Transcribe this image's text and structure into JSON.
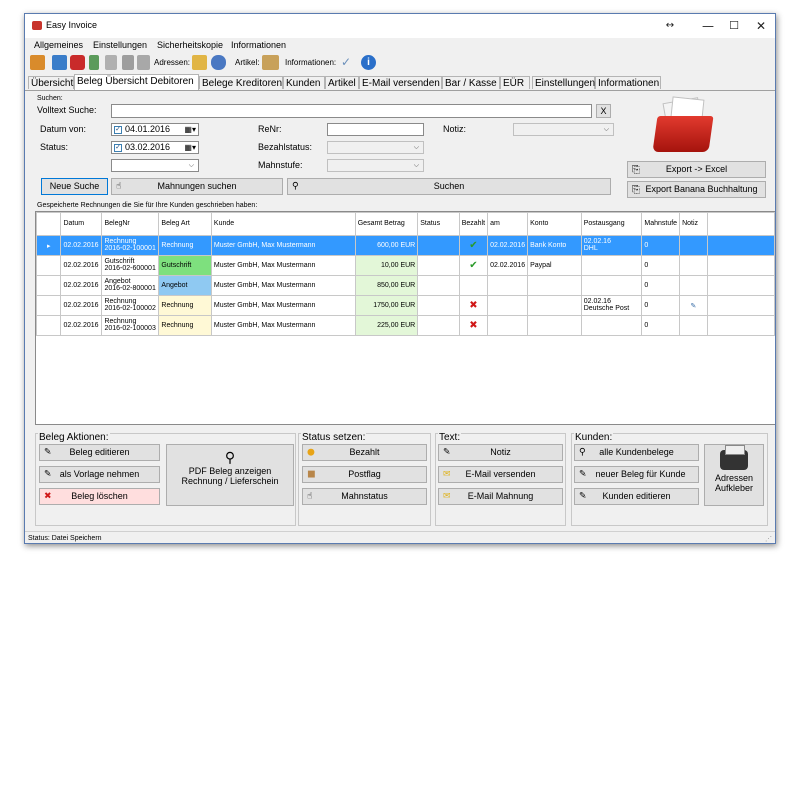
{
  "window": {
    "title": "Easy Invoice",
    "restore_icon": "double-arrow-icon",
    "minimize": "—",
    "maximize": "☐",
    "close": "✕"
  },
  "menu": [
    "Allgemeines",
    "Einstellungen",
    "Sicherheitskopie",
    "Informationen"
  ],
  "toolbar": {
    "adressen": "Adressen:",
    "artikel": "Artikel:",
    "informationen": "Informationen:"
  },
  "tabs": [
    "Übersicht",
    "Beleg Übersicht Debitoren",
    "Belege Kreditoren",
    "Kunden",
    "Artikel",
    "E-Mail versenden",
    "Bar / Kasse",
    "EÜR",
    "Einstellungen",
    "Informationen"
  ],
  "active_tab": 1,
  "search": {
    "section": "Suchen:",
    "volltext_label": "Volltext Suche:",
    "volltext_value": "",
    "clear": "X",
    "datum_von_label": "Datum von:",
    "datum_von_value": "04.01.2016",
    "status_label": "Status:",
    "status_date_value": "03.02.2016",
    "renr_label": "ReNr:",
    "notiz_label": "Notiz:",
    "bezahlstatus_label": "Bezahlstatus:",
    "mahnstufe_label": "Mahnstufe:",
    "neue_suche": "Neue Suche",
    "mahnungen_suchen": "Mahnungen suchen",
    "suchen": "Suchen"
  },
  "export": {
    "excel": "Export -> Excel",
    "banana": "Export Banana Buchhaltung"
  },
  "grid": {
    "caption": "Gespeicherte Rechnungen die Sie für Ihre Kunden geschrieben haben:",
    "headers": [
      "Datum",
      "BelegNr",
      "Beleg Art",
      "Kunde",
      "Gesamt Betrag",
      "Status",
      "Bezahlt",
      "am",
      "Konto",
      "Postausgang",
      "Mahnstufe",
      "Notiz"
    ],
    "rows": [
      {
        "datum": "02.02.2016",
        "nr1": "Rechnung",
        "nr2": "2016-02-100001",
        "art": "Rechnung",
        "kunde": "Muster GmbH, Max Mustermann",
        "betrag": "600,00 EUR",
        "status": "",
        "bezahlt": "check",
        "am": "02.02.2016",
        "konto": "Bank Konto",
        "post1": "02.02.16",
        "post2": "DHL",
        "mahn": "0",
        "notiz": ""
      },
      {
        "datum": "02.02.2016",
        "nr1": "Gutschrift",
        "nr2": "2016-02-600001",
        "art": "Gutschrift",
        "kunde": "Muster GmbH, Max Mustermann",
        "betrag": "10,00 EUR",
        "status": "",
        "bezahlt": "check",
        "am": "02.02.2016",
        "konto": "Paypal",
        "post1": "",
        "post2": "",
        "mahn": "0",
        "notiz": ""
      },
      {
        "datum": "02.02.2016",
        "nr1": "Angebot",
        "nr2": "2016-02-800001",
        "art": "Angebot",
        "kunde": "Muster GmbH, Max Mustermann",
        "betrag": "850,00 EUR",
        "status": "",
        "bezahlt": "",
        "am": "",
        "konto": "",
        "post1": "",
        "post2": "",
        "mahn": "0",
        "notiz": ""
      },
      {
        "datum": "02.02.2016",
        "nr1": "Rechnung",
        "nr2": "2016-02-100002",
        "art": "Rechnung",
        "kunde": "Muster GmbH, Max Mustermann",
        "betrag": "1750,00 EUR",
        "status": "",
        "bezahlt": "cross",
        "am": "",
        "konto": "",
        "post1": "02.02.16",
        "post2": "Deutsche Post",
        "mahn": "0",
        "notiz": "note"
      },
      {
        "datum": "02.02.2016",
        "nr1": "Rechnung",
        "nr2": "2016-02-100003",
        "art": "Rechnung",
        "kunde": "Muster GmbH, Max Mustermann",
        "betrag": "225,00 EUR",
        "status": "",
        "bezahlt": "cross",
        "am": "",
        "konto": "",
        "post1": "",
        "post2": "",
        "mahn": "0",
        "notiz": ""
      }
    ],
    "art_colors": {
      "Rechnung": "#fff9d6",
      "Gutschrift": "#7ee07e",
      "Angebot": "#8fc9f2"
    },
    "betrag_color": "#e3f7d8",
    "selected_color": "#3399ff"
  },
  "beleg_aktionen": {
    "title": "Beleg Aktionen:",
    "edit": "Beleg editieren",
    "vorlage": "als Vorlage nehmen",
    "delete": "Beleg löschen",
    "pdf1": "PDF Beleg anzeigen",
    "pdf2": "Rechnung / Lieferschein"
  },
  "status_setzen": {
    "title": "Status setzen:",
    "bezahlt": "Bezahlt",
    "postflag": "Postflag",
    "mahnstatus": "Mahnstatus"
  },
  "text": {
    "title": "Text:",
    "notiz": "Notiz",
    "email": "E-Mail versenden",
    "mahnung": "E-Mail Mahnung"
  },
  "kunden": {
    "title": "Kunden:",
    "alle": "alle Kundenbelege",
    "neuer": "neuer Beleg für Kunde",
    "editieren": "Kunden editieren",
    "adressen1": "Adressen",
    "adressen2": "Aufkleber"
  },
  "statusbar": {
    "text": "Status:  Datei Speichern"
  }
}
